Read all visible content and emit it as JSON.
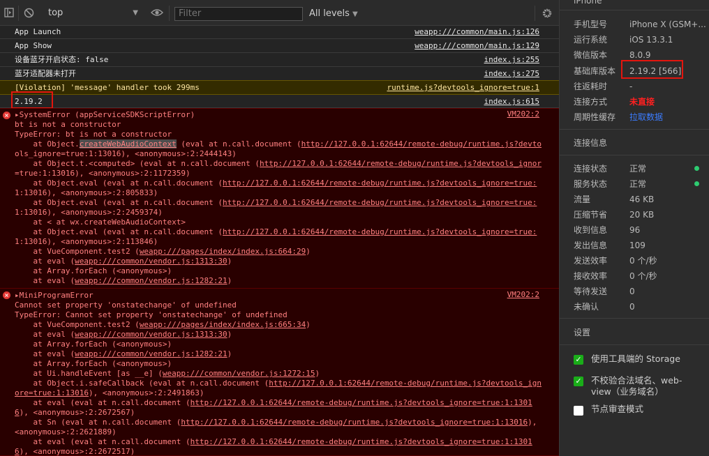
{
  "toolbar": {
    "context": "top",
    "filter_placeholder": "Filter",
    "levels": "All levels"
  },
  "rows": [
    {
      "msg": "App Launch",
      "src": "weapp:///common/main.js:126"
    },
    {
      "msg": "App Show",
      "src": "weapp:///common/main.js:129"
    },
    {
      "msg": "设备蓝牙开启状态: false",
      "src": "index.js:255"
    },
    {
      "msg": "蓝牙适配器未打开",
      "src": "index.js:275"
    }
  ],
  "warning": {
    "msg": "[Violation] 'message' handler took 299ms",
    "src": "runtime.js?devtools_ignore=true:1"
  },
  "version_row": {
    "msg": "2.19.2",
    "src": "index.js:615"
  },
  "error1": {
    "title": "SystemError (appServiceSDKScriptError)",
    "src": "VM202:2",
    "lines": [
      "bt is not a constructor",
      "TypeError: bt is not a constructor",
      "    at Object.",
      "ols_ignore=true:1:13016), <anonymous>:2:2444143)",
      "    at Object.t.<computed> (eval at n.call.document (",
      "=true:1:13016), <anonymous>:2:1172359)",
      "    at Object.eval (eval at n.call.document (",
      "1:13016), <anonymous>:2:805833)",
      "    at Object.eval (eval at n.call.document (",
      "1:13016), <anonymous>:2:2459374)",
      "    at < at wx.createWebAudioContext>",
      "    at Object.eval (eval at n.call.document (",
      "1:13016), <anonymous>:2:113846)",
      "    at VueComponent.test2 (",
      "    at eval (",
      "    at Array.forEach (<anonymous>)",
      "    at eval ("
    ],
    "fn_highlight": "createWebAudioContext",
    "fn_rest": " (eval at n.call.document (",
    "link_url": "http://127.0.0.1:62644/remote-debug/runtime.js?devtools_ignore=true:",
    "link_url2": "http://127.0.0.1:62644/remote-debug/runtime.js?devtools_ignor",
    "link_url3": "http://127.0.0.1:62644/remote-debug/runtime.js?devto",
    "link_tail1": "ols_ignore=true:1:13016",
    "link_tail2": "e=true:1:13016",
    "link_tail3": "1:13016",
    "vue_link": "weapp:///pages/index/index.js:664:29",
    "vendor1": "weapp:///common/vendor.js:1313:30",
    "vendor2": "weapp:///common/vendor.js:1282:21"
  },
  "error2": {
    "title": "MiniProgramError",
    "src": "VM202:2",
    "l1": "Cannot set property 'onstatechange' of undefined",
    "l2": "TypeError: Cannot set property 'onstatechange' of undefined",
    "vue": "    at VueComponent.test2 (",
    "vue_link": "weapp:///pages/index/index.js:665:34",
    "eval": "    at eval (",
    "vendor1": "weapp:///common/vendor.js:1313:30",
    "foreach": "    at Array.forEach (<anonymous>)",
    "vendor2": "weapp:///common/vendor.js:1282:21",
    "ui": "    at Ui.handleEvent [as __e] (",
    "vendor3": "weapp:///common/vendor.js:1272:15",
    "safe": "    at Object.i.safeCallback (eval at n.call.document (",
    "safe_link": "http://127.0.0.1:62644/remote-debug/runtime.js?devtools_ign",
    "safe_tail_link": "ore=true:1:13016",
    "safe_tail_rest": "), <anonymous>:2:2491863)",
    "evaleval": "    at eval (eval at n.call.document (",
    "ee_link": "http://127.0.0.1:62644/remote-debug/runtime.js?devtools_ignore=true:1:1301",
    "ee_tail_link": "6",
    "ee_tail_rest1": "), <anonymous>:2:2672567)",
    "sn": "    at Sn (eval at n.call.document (",
    "sn_link": "http://127.0.0.1:62644/remote-debug/runtime.js?devtools_ignore=true:1:13016",
    "sn_rest": "),",
    "sn_tail": "<anonymous>:2:2621889)",
    "ee_tail_rest2": "), <anonymous>:2:2672517)"
  },
  "panel": {
    "top_title": "iPhone",
    "device": [
      {
        "label": "手机型号",
        "value": "iPhone X (GSM+..."
      },
      {
        "label": "运行系统",
        "value": "iOS 13.3.1"
      },
      {
        "label": "微信版本",
        "value": "8.0.9"
      },
      {
        "label": "基础库版本",
        "value": "2.19.2 [566]"
      },
      {
        "label": "往返耗时",
        "value": "-"
      },
      {
        "label": "连接方式",
        "value": "未直接"
      },
      {
        "label": "周期性缓存",
        "value": "拉取数据"
      }
    ],
    "conn_title": "连接信息",
    "conn": [
      {
        "label": "连接状态",
        "value": "正常"
      },
      {
        "label": "服务状态",
        "value": "正常"
      },
      {
        "label": "流量",
        "value": "46 KB"
      },
      {
        "label": "压缩节省",
        "value": "20 KB"
      },
      {
        "label": "收到信息",
        "value": "96"
      },
      {
        "label": "发出信息",
        "value": "109"
      },
      {
        "label": "发送效率",
        "value": "0 个/秒"
      },
      {
        "label": "接收效率",
        "value": "0 个/秒"
      },
      {
        "label": "等待发送",
        "value": "0"
      },
      {
        "label": "未确认",
        "value": "0"
      }
    ],
    "settings_title": "设置",
    "settings": [
      {
        "label": "使用工具端的 Storage",
        "checked": true
      },
      {
        "label": "不校验合法域名、web-",
        "label2": "view（业务域名）",
        "checked": true
      },
      {
        "label": "节点审查模式",
        "checked": false
      }
    ],
    "colors": {
      "ok": "#2ecc71",
      "warn_red": "#ff2020",
      "link_blue": "#3b7cff"
    }
  }
}
